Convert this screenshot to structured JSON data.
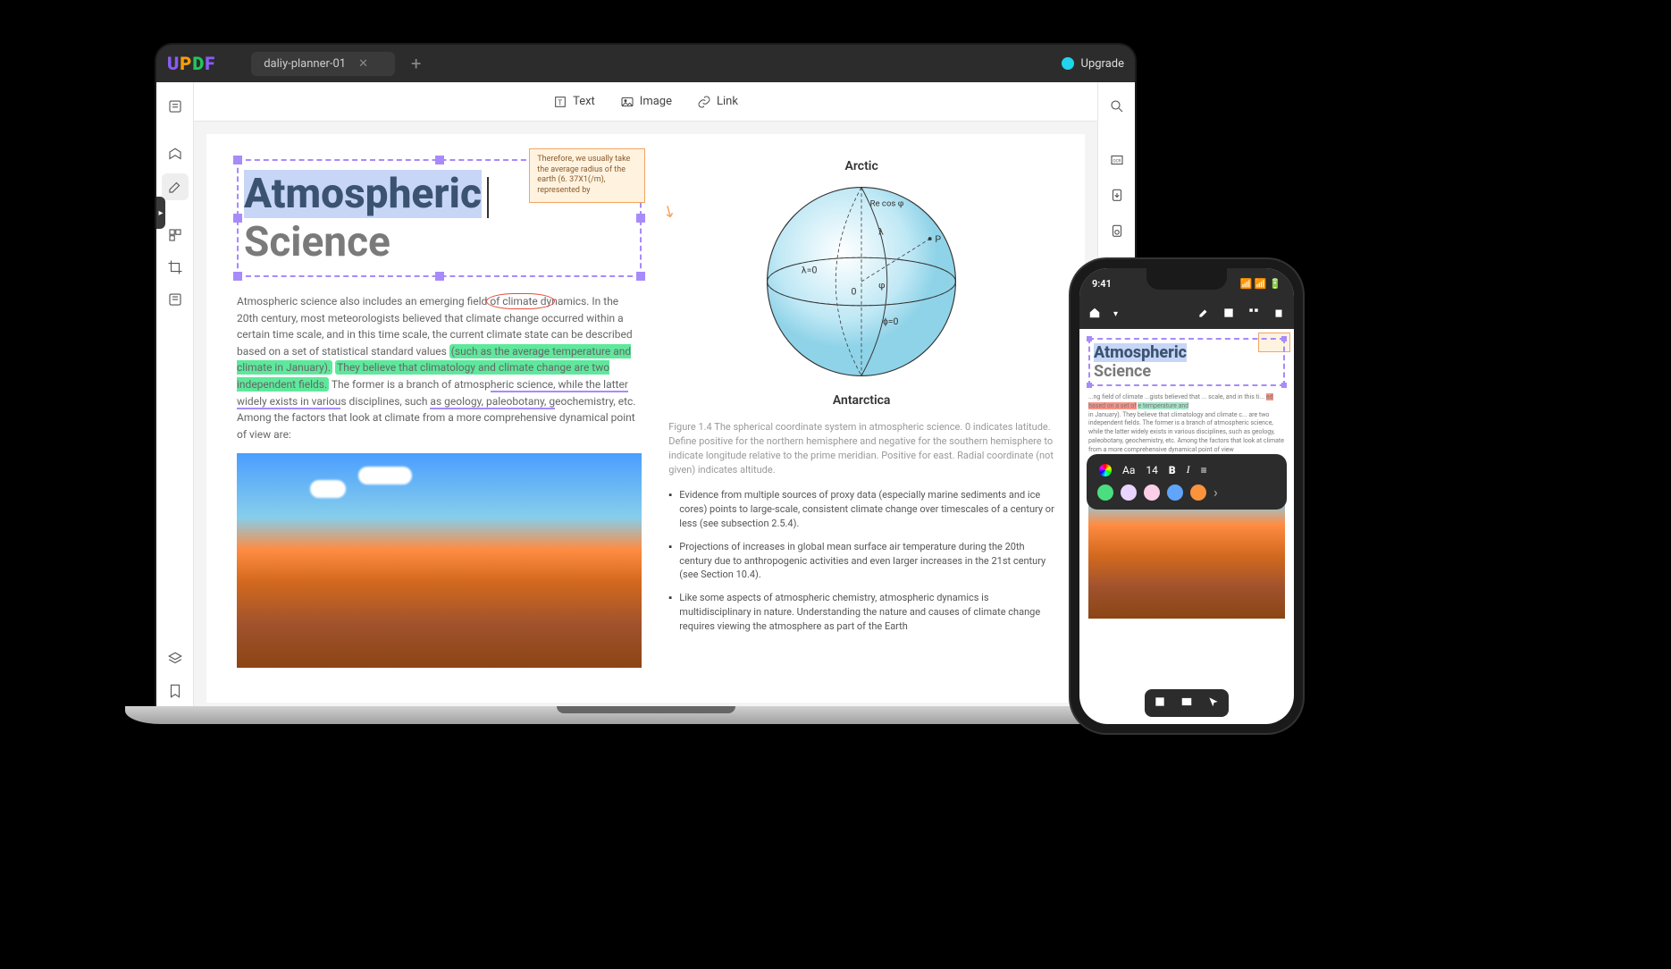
{
  "titlebar": {
    "tab_name": "daliy-planner-01",
    "upgrade": "Upgrade"
  },
  "toolbar": {
    "text": "Text",
    "image": "Image",
    "link": "Link"
  },
  "doc": {
    "title_selected": "Atmospheric",
    "title_rest": "Science",
    "para_start": "Atmospheric science also includes an emerging field ",
    "para_circ": "of climate dy",
    "para_after_circ": "namics. In the 20th century, most meteorologists believed that climate change occurred within a certain time scale, and in this time scale, the current climate state can be described based on a set of statistical standard values ",
    "para_hl1": "(such as the average temperature and climate in January).",
    "para_hl2": "They believe that climatology and climate change are two independent fields.",
    "para_after_hl": " The former is a branch of atmosp",
    "para_underline": "heric science, while the latter widely exists in variou",
    "para_after_ul": "s disciplines, such ",
    "para_squiggle": "as geology, paleobotany, g",
    "para_end": "eochemistry, etc. Among the factors that look at climate from a more comprehensive dynamical point of view are:",
    "callout": "Therefore, we usually take the average radius of the earth (6. 37X1(/m), represented by",
    "sphere_top": "Arctic",
    "sphere_bot": "Antarctica",
    "sphere_lambda0": "λ=0",
    "sphere_zero": "0",
    "sphere_phi": "φ",
    "sphere_phi0": "ɸ=0",
    "sphere_lambda": "λ",
    "sphere_rcos": "Re cos φ",
    "sphere_p": "P",
    "caption": "Figure 1.4 The spherical coordinate system in atmospheric science. 0 indicates latitude. Define positive for the northern hemisphere and negative for the southern hemisphere to indicate longitude relative to the prime meridian. Positive for east. Radial coordinate (not given) indicates altitude.",
    "bullet1": "Evidence from multiple sources of proxy data (especially marine sediments and ice cores) points to large-scale, consistent climate change over timescales of a century or less (see subsection 2.5.4).",
    "bullet2": "Projections of increases in global mean surface air temperature during the 20th century due to anthropogenic activities and even larger increases in the 21st century (see Section 10.4).",
    "bullet3": "Like some aspects of atmospheric chemistry, atmospheric dynamics is multidisciplinary in nature. Understanding the nature and causes of climate change requires viewing the atmosphere as part of the Earth"
  },
  "phone": {
    "time": "9:41",
    "title_sel": "Atmospheric",
    "title_rest": "Science",
    "para": "...ng field of climate ...gists believed that ... scale, and in this ti...",
    "hl1": "ed based on a set of",
    "hl2": "e temperature and",
    "para2": "in January). They believe that climatology and climate c... are two independent fields. The former is a branch of atmospheric science, while the latter widely exists in various disciplines, such as geology, paleobotany, geochemistry, etc. Among the factors that look at climate from a more comprehensive dynamical point of view",
    "format_aa": "Aa",
    "format_size": "14",
    "format_b": "B",
    "format_i": "I",
    "colors": [
      "#4ade80",
      "#e9d5ff",
      "#fbcfe8",
      "#60a5fa",
      "#fb923c"
    ]
  }
}
